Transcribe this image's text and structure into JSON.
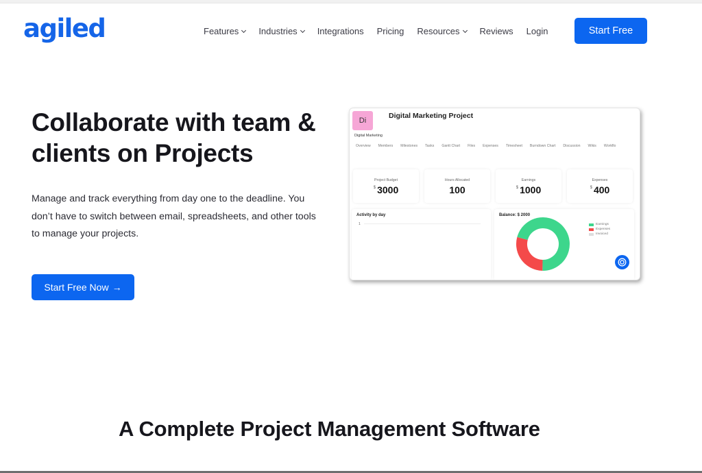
{
  "header": {
    "logo": "agiled",
    "nav": [
      {
        "label": "Features",
        "dropdown": true
      },
      {
        "label": "Industries",
        "dropdown": true
      },
      {
        "label": "Integrations",
        "dropdown": false
      },
      {
        "label": "Pricing",
        "dropdown": false
      },
      {
        "label": "Resources",
        "dropdown": true
      },
      {
        "label": "Reviews",
        "dropdown": false
      },
      {
        "label": "Login",
        "dropdown": false
      }
    ],
    "cta": "Start Free"
  },
  "hero": {
    "title": "Collaborate with team & clients on Projects",
    "description": "Manage and track everything from day one to the deadline. You don’t have to switch between email, spreadsheets, and other tools to manage your projects.",
    "cta": "Start Free Now",
    "cta_icon": "arrow-right-icon"
  },
  "dashboard": {
    "badge": "Di",
    "title": "Digital Marketing Project",
    "subtitle": "Digital Marketing",
    "tabs": [
      "Overview",
      "Members",
      "Milestones",
      "Tasks",
      "Gantt Chart",
      "Files",
      "Expenses",
      "Timesheet",
      "Burndown Chart",
      "Discussion",
      "Wikis",
      "Workflo"
    ],
    "cards": [
      {
        "label": "Project Budget",
        "currency": "$",
        "value": "3000"
      },
      {
        "label": "Hours Allocated",
        "currency": "",
        "value": "100"
      },
      {
        "label": "Earnings",
        "currency": "$",
        "value": "1000"
      },
      {
        "label": "Expenses",
        "currency": "$",
        "value": "400"
      }
    ],
    "activity": {
      "title": "Activity by day",
      "axis_top": "1"
    },
    "balance": {
      "title": "Balance: $ 2000",
      "legend": [
        {
          "label": "Earnings",
          "color": "#3dd68c"
        },
        {
          "label": "Expenses",
          "color": "#f44a4a"
        },
        {
          "label": "Invoiced",
          "color": "#dddddd"
        }
      ],
      "slices": [
        {
          "name": "Earnings",
          "value": 0.71,
          "color": "#3dd68c"
        },
        {
          "name": "Expenses",
          "value": 0.29,
          "color": "#f44a4a"
        }
      ]
    },
    "help_icon": "life-ring-icon"
  },
  "section": {
    "title": "A Complete Project Management Software"
  },
  "colors": {
    "brand": "#1565e8",
    "button": "#0c66f0"
  }
}
